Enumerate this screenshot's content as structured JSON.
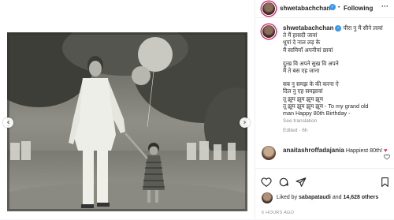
{
  "post": {
    "author": "shwetabachchan",
    "follow_label": "Following",
    "separator": "•",
    "more_label": "···"
  },
  "caption": {
    "author": "shwetabachchan",
    "lines": [
      "पीरा नु मैं सीने लावां",
      "ते मैं हासदी जावां",
      "धूपां दे नाल लड़ के",
      "मैं सामियाँ अपनीयां छावां",
      "",
      "दुःख वि अपने सुख वि अपने",
      "मैं ते बस एह जाना",
      "",
      "सब नु समझ के की करना ऐ",
      "दिल नु एह समझावां",
      "तू झूम झूम झूम झूम",
      "तू झूम झूम झूम झूम - To my grand old",
      "man Happy 80th Birthday -"
    ],
    "see_translation": "See translation",
    "age": "Edited · 6h"
  },
  "comment": {
    "author": "anaitashroffadajania",
    "text": "Happiest 80th!",
    "heart": "♥"
  },
  "likes": {
    "prefix": "Liked by",
    "user": "sabapataudi",
    "and_label": "and",
    "others": "14,628 others"
  },
  "timestamp": "6 HOURS AGO",
  "photo": {
    "prev_icon": "‹",
    "next_icon": "›",
    "tone": "sepia-bw"
  }
}
